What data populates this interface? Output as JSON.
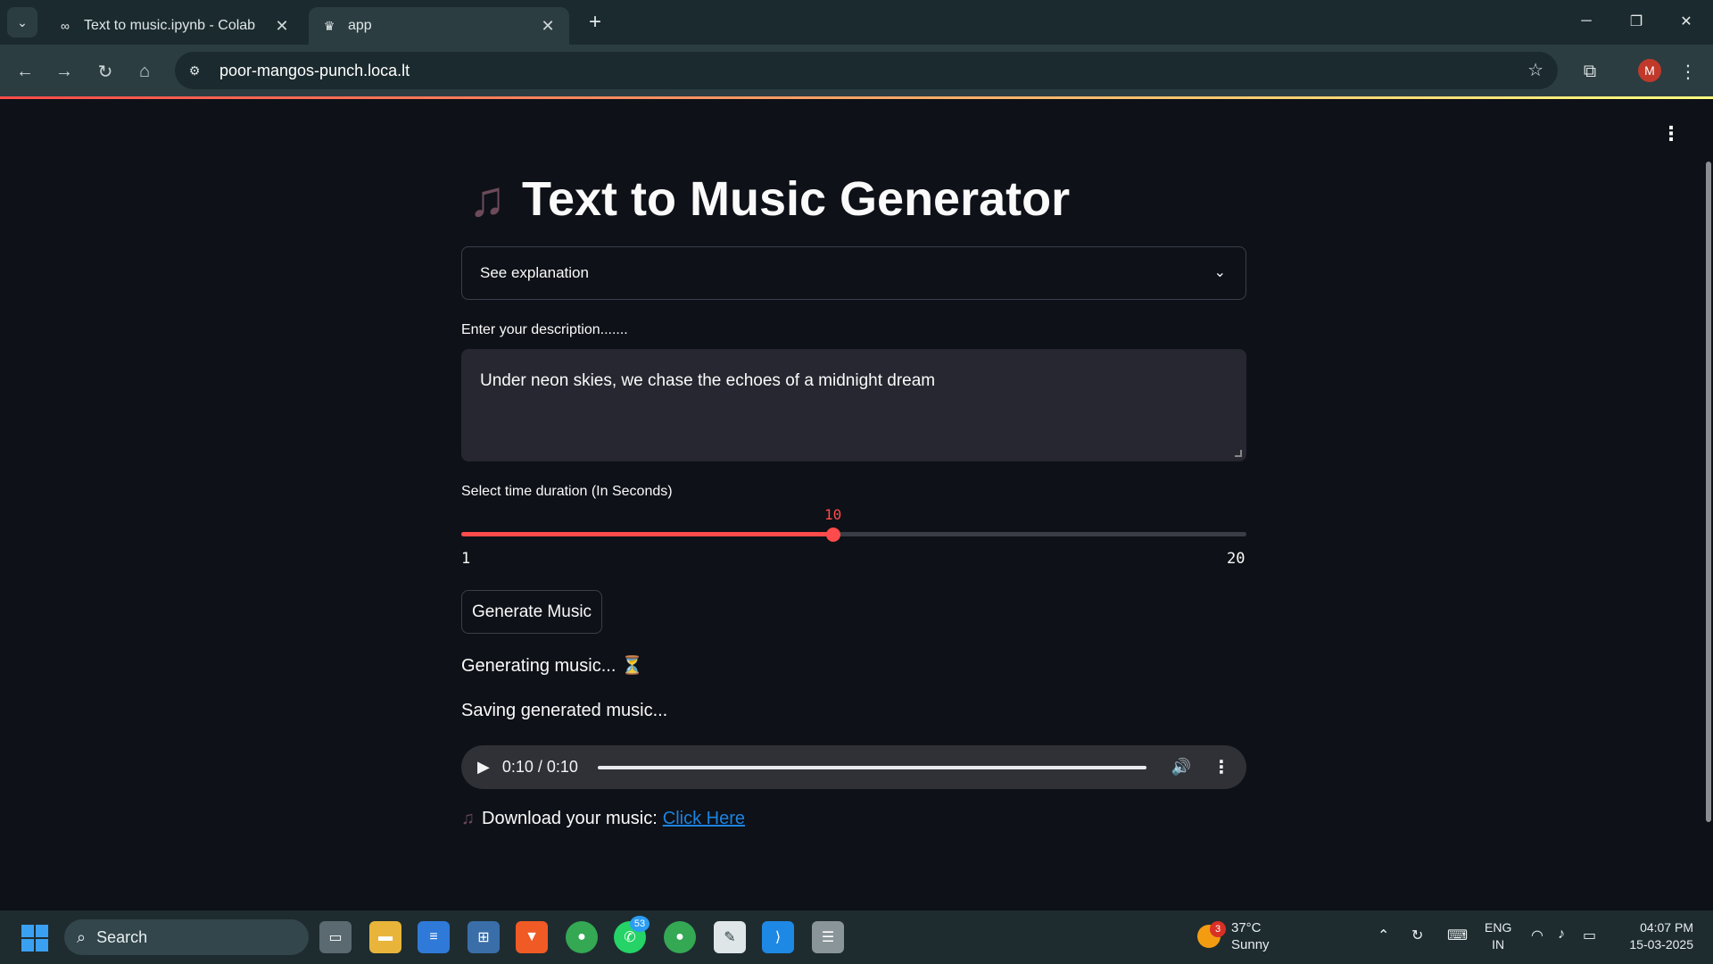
{
  "browser": {
    "tabs": [
      {
        "title": "Text to music.ipynb - Colab",
        "favicon": "colab-icon"
      },
      {
        "title": "app",
        "favicon": "streamlit-crown-icon"
      }
    ],
    "url": "poor-mangos-punch.loca.lt",
    "profile_initial": "M",
    "accent_loading": "#ff4b4b"
  },
  "app": {
    "title_emoji": "♫",
    "title": "Text to Music Generator",
    "expander_label": "See explanation",
    "description_label": "Enter your description.......",
    "description_value": "Under neon skies, we chase the echoes of a midnight dream",
    "slider_label": "Select time duration (In Seconds)",
    "slider_value": "10",
    "slider_value_fraction": 0.4737,
    "slider_min": "1",
    "slider_max": "20",
    "generate_button": "Generate Music",
    "status_generating": "Generating music... ⏳",
    "status_saving": "Saving generated music...",
    "audio_time": "0:10 / 0:10",
    "download_text": "Download your music:",
    "download_link": "Click Here",
    "accent_color": "#ff4b4b",
    "link_color": "#1c83e1"
  },
  "taskbar": {
    "search_placeholder": "Search",
    "whatsapp_badge": "53",
    "weather_badge": "3",
    "temperature": "37°C",
    "weather": "Sunny",
    "lang_line1": "ENG",
    "lang_line2": "IN",
    "time": "04:07 PM",
    "date": "15-03-2025"
  }
}
